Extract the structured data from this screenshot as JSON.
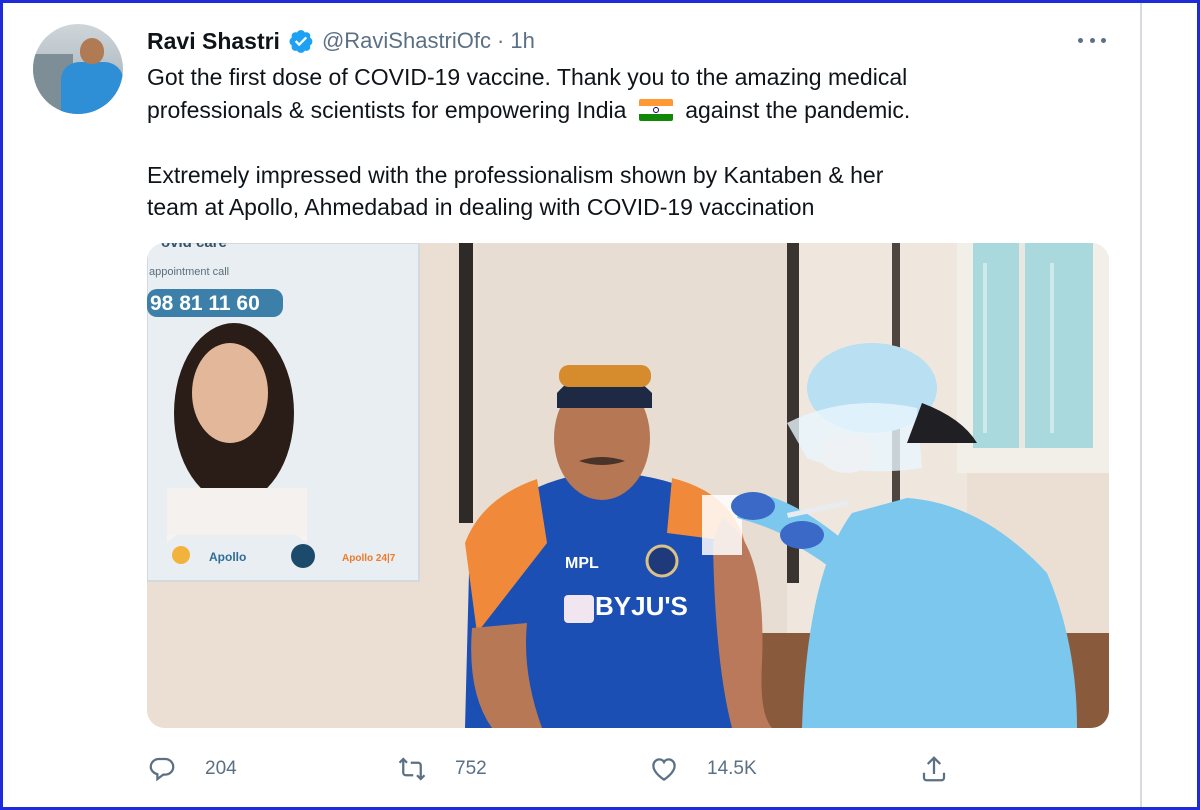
{
  "tweet": {
    "author_name": "Ravi Shastri",
    "handle": "@RaviShastriOfc",
    "separator": "·",
    "time": "1h",
    "text_line1": "Got the first dose of COVID-19 vaccine. Thank you to the amazing medical",
    "text_line2_before_flag": "professionals & scientists for empowering India",
    "text_line2_after_flag": "against the pandemic.",
    "text_line3": "Extremely impressed with the professionalism shown by Kantaben & her",
    "text_line4": "team at Apollo, Ahmedabad in dealing with COVID-19 vaccination",
    "flag_emoji": "india-flag"
  },
  "photo": {
    "poster_text_top": "ovid care",
    "poster_text_appointment": "appointment call",
    "poster_phone": "98 81 11 60",
    "poster_logo_apollo": "Apollo",
    "poster_logo_247": "Apollo 24|7",
    "jersey_brand": "BYJU'S",
    "jersey_sponsor": "MPL"
  },
  "actions": {
    "reply_count": "204",
    "retweet_count": "752",
    "like_count": "14.5K"
  },
  "icons": {
    "verified": "verified-badge-icon",
    "more": "more-options-icon",
    "reply": "reply-icon",
    "retweet": "retweet-icon",
    "like": "like-icon",
    "share": "share-icon"
  },
  "colors": {
    "frame_border": "#1d2bd8",
    "verified_blue": "#1da1f2",
    "secondary_text": "#5b7083",
    "primary_text": "#0f1419"
  }
}
